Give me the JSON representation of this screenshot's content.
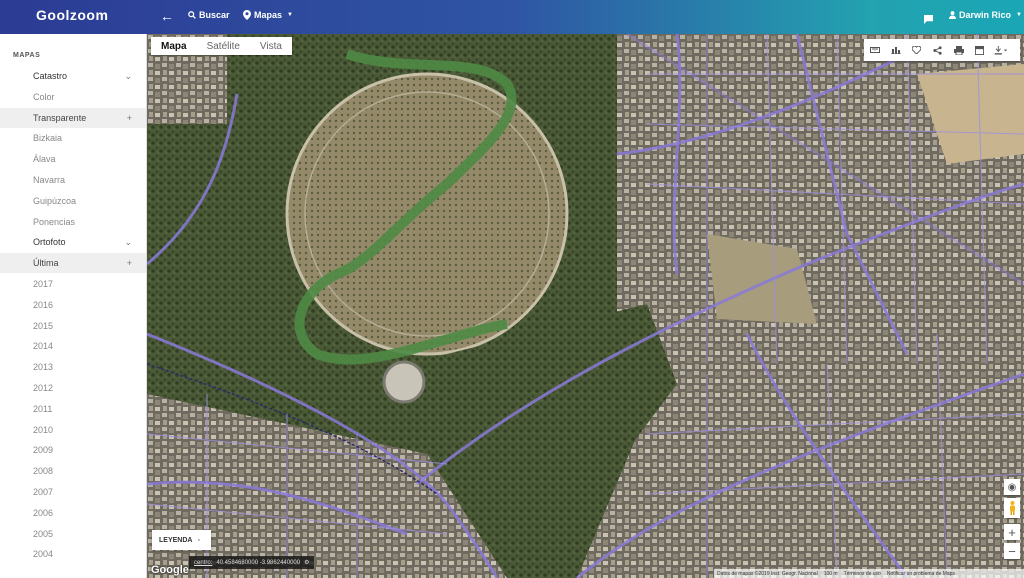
{
  "app": {
    "brand": "Goolzoom"
  },
  "topbar": {
    "buscar_label": "Buscar",
    "mapas_label": "Mapas",
    "user_name": "Darwin Rico"
  },
  "sidebar": {
    "heading": "MAPAS",
    "rows": [
      {
        "label": "Catastro",
        "kind": "group",
        "ctrl": "chevron-down",
        "ctrl_text": "⌄"
      },
      {
        "label": "Color",
        "kind": "sub"
      },
      {
        "label": "Transparente",
        "kind": "sub",
        "selected": true,
        "ctrl": "plus",
        "ctrl_text": "+"
      },
      {
        "label": "Bizkaia",
        "kind": "sub"
      },
      {
        "label": "Álava",
        "kind": "sub"
      },
      {
        "label": "Navarra",
        "kind": "sub"
      },
      {
        "label": "Guipúzcoa",
        "kind": "sub"
      },
      {
        "label": "Ponencias",
        "kind": "sub"
      },
      {
        "label": "Ortofoto",
        "kind": "group",
        "ctrl": "chevron-down",
        "ctrl_text": "⌄"
      },
      {
        "label": "Última",
        "kind": "sub",
        "selected": true,
        "ctrl": "plus",
        "ctrl_text": "+"
      },
      {
        "label": "2017",
        "kind": "sub"
      },
      {
        "label": "2016",
        "kind": "sub"
      },
      {
        "label": "2015",
        "kind": "sub"
      },
      {
        "label": "2014",
        "kind": "sub"
      },
      {
        "label": "2013",
        "kind": "sub"
      },
      {
        "label": "2012",
        "kind": "sub"
      },
      {
        "label": "2011",
        "kind": "sub"
      },
      {
        "label": "2010",
        "kind": "sub"
      },
      {
        "label": "2009",
        "kind": "sub"
      },
      {
        "label": "2008",
        "kind": "sub"
      },
      {
        "label": "2007",
        "kind": "sub"
      },
      {
        "label": "2006",
        "kind": "sub"
      },
      {
        "label": "2005",
        "kind": "sub"
      },
      {
        "label": "2004",
        "kind": "sub"
      }
    ]
  },
  "map": {
    "type_tabs": [
      "Mapa",
      "Satélite",
      "Vista"
    ],
    "active_tab": "Mapa",
    "toolbar_icons": [
      "ruler-icon",
      "chart-icon",
      "heart-icon",
      "share-icon",
      "print-icon",
      "layers-icon",
      "download-icon"
    ],
    "leyenda_label": "LEYENDA",
    "coords_key": "centro:",
    "coords_value": "40.4584680000 -3.9862440000",
    "google_label": "Google",
    "attribution": [
      "Datos de mapas ©2019 Inst. Geogr. Nacional",
      "100 m",
      "Términos de uso",
      "Notificar un problema de Maps"
    ]
  },
  "colors": {
    "topbar_start": "#2c3b94",
    "topbar_end": "#1aa6b5",
    "selected_row_bg": "#efefef",
    "road_overlay": "#8a7ad8"
  }
}
